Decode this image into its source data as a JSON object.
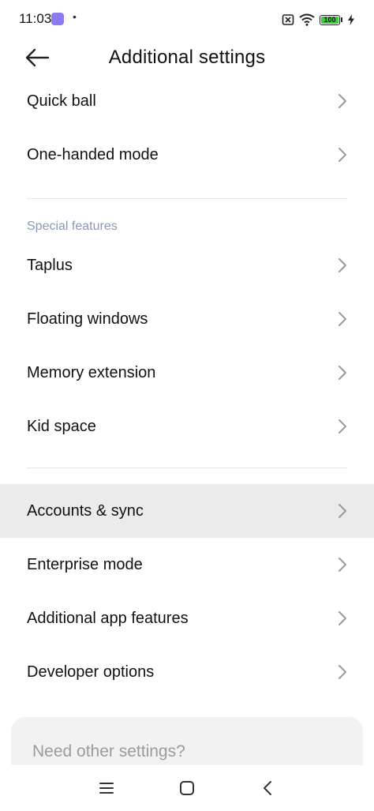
{
  "status_bar": {
    "time": "11:03",
    "battery": "100",
    "icons": [
      "app-notification-icon",
      "sim-icon",
      "wifi-icon",
      "battery-icon",
      "charging-bolt-icon"
    ]
  },
  "header": {
    "title": "Additional settings",
    "back_icon": "arrow-left-icon"
  },
  "groups": {
    "top": [
      {
        "label": "Quick ball"
      },
      {
        "label": "One-handed mode"
      }
    ],
    "special": {
      "title": "Special features",
      "items": [
        {
          "label": "Taplus"
        },
        {
          "label": "Floating windows"
        },
        {
          "label": "Memory extension"
        },
        {
          "label": "Kid space"
        }
      ]
    },
    "bottom": [
      {
        "label": "Accounts & sync",
        "highlighted": true
      },
      {
        "label": "Enterprise mode"
      },
      {
        "label": "Additional app features"
      },
      {
        "label": "Developer options"
      }
    ]
  },
  "suggestion_card": {
    "text": "Need other settings?"
  },
  "nav_bar": {
    "icons": [
      "menu-icon",
      "home-square-icon",
      "back-chevron-icon"
    ]
  },
  "colors": {
    "section_title": "#8d98b6",
    "highlight_row": "#ebebeb",
    "battery_fill": "#3ccf3c",
    "app_icon": "#8a7cf0"
  }
}
